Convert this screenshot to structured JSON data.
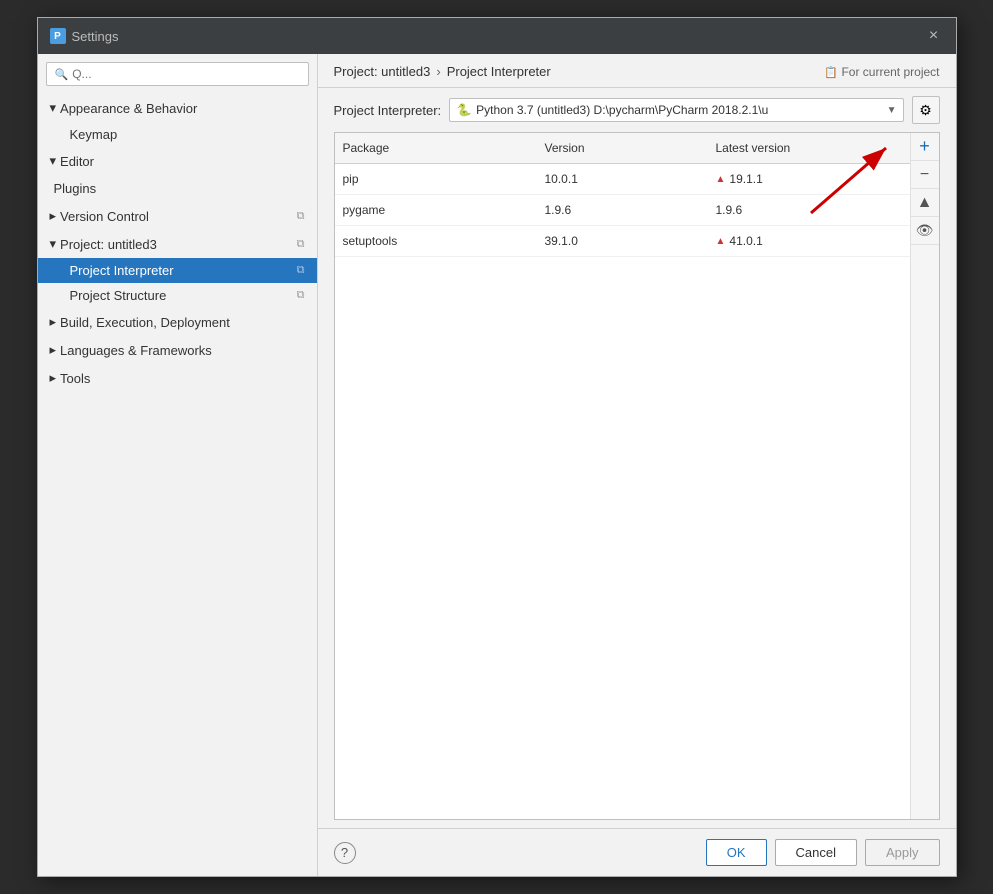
{
  "dialog": {
    "title": "Settings",
    "title_icon": "P",
    "close_label": "×"
  },
  "sidebar": {
    "search_placeholder": "Q...",
    "items": [
      {
        "id": "appearance-behavior",
        "label": "Appearance & Behavior",
        "type": "group",
        "expanded": true,
        "indent": 0
      },
      {
        "id": "keymap",
        "label": "Keymap",
        "type": "item",
        "indent": 1
      },
      {
        "id": "editor",
        "label": "Editor",
        "type": "group",
        "expanded": true,
        "indent": 0
      },
      {
        "id": "plugins",
        "label": "Plugins",
        "type": "item",
        "indent": 0
      },
      {
        "id": "version-control",
        "label": "Version Control",
        "type": "group",
        "expanded": false,
        "indent": 0
      },
      {
        "id": "project-untitled3",
        "label": "Project: untitled3",
        "type": "group",
        "expanded": true,
        "indent": 0
      },
      {
        "id": "project-interpreter",
        "label": "Project Interpreter",
        "type": "child",
        "active": true,
        "indent": 1
      },
      {
        "id": "project-structure",
        "label": "Project Structure",
        "type": "child",
        "active": false,
        "indent": 1
      },
      {
        "id": "build-execution",
        "label": "Build, Execution, Deployment",
        "type": "group",
        "expanded": false,
        "indent": 0
      },
      {
        "id": "languages-frameworks",
        "label": "Languages & Frameworks",
        "type": "group",
        "expanded": false,
        "indent": 0
      },
      {
        "id": "tools",
        "label": "Tools",
        "type": "group",
        "expanded": false,
        "indent": 0
      }
    ]
  },
  "breadcrumb": {
    "project": "Project: untitled3",
    "separator": "›",
    "current": "Project Interpreter",
    "for_current": "For current project"
  },
  "interpreter": {
    "label": "Project Interpreter:",
    "icon": "🐍",
    "value": "Python 3.7 (untitled3) D:\\pycharm\\PyCharm 2018.2.1\\u",
    "gear_icon": "⚙"
  },
  "table": {
    "columns": [
      "Package",
      "Version",
      "Latest version"
    ],
    "rows": [
      {
        "package": "pip",
        "version": "10.0.1",
        "latest": "19.1.1",
        "has_upgrade": true
      },
      {
        "package": "pygame",
        "version": "1.9.6",
        "latest": "1.9.6",
        "has_upgrade": false
      },
      {
        "package": "setuptools",
        "version": "39.1.0",
        "latest": "41.0.1",
        "has_upgrade": true
      }
    ]
  },
  "sidebar_buttons": {
    "add": "+",
    "remove": "−",
    "scroll_up": "▲",
    "eye": "👁"
  },
  "footer": {
    "help": "?",
    "ok": "OK",
    "cancel": "Cancel",
    "apply": "Apply"
  }
}
